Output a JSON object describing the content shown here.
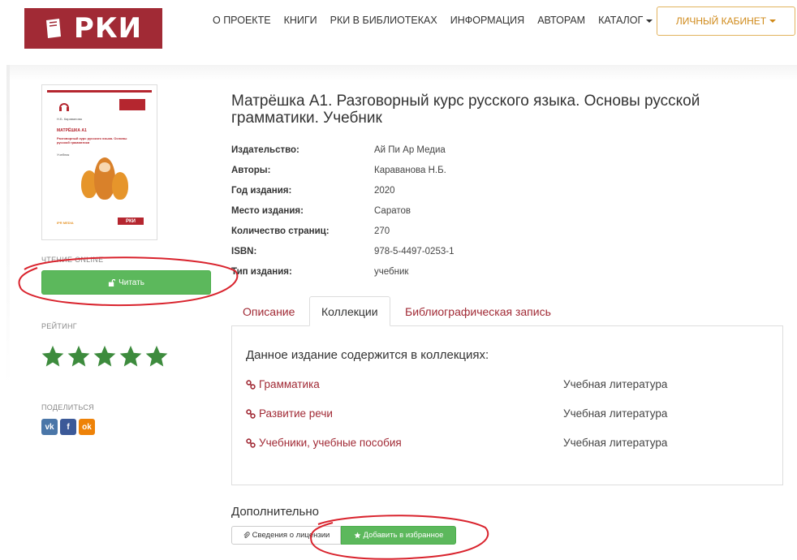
{
  "header": {
    "logo_text": "РКИ",
    "nav": [
      "О ПРОЕКТЕ",
      "КНИГИ",
      "РКИ В БИБЛИОТЕКАХ",
      "ИНФОРМАЦИЯ",
      "АВТОРАМ",
      "КАТАЛОГ"
    ],
    "cabinet_label": "ЛИЧНЫЙ КАБИНЕТ"
  },
  "cover": {
    "author": "Н.Б. Караванова",
    "title": "МАТРЁШКА А1",
    "subtitle": "Разговорный курс русского языка. Основы русской грамматики",
    "type": "Учебник",
    "publisher": "IPR MEDIA",
    "brand": "РКИ"
  },
  "sidebar": {
    "read_online_label": "ЧТЕНИЕ ONLINE",
    "read_button": "Читать",
    "rating_label": "РЕЙТИНГ",
    "rating_stars": 5,
    "share_label": "ПОДЕЛИТЬСЯ",
    "share_buttons": [
      "vk",
      "f",
      "ok"
    ]
  },
  "book": {
    "title": "Матрёшка А1. Разговорный курс русского языка. Основы русской грамматики. Учебник",
    "properties": [
      {
        "key": "Издательство:",
        "value": "Ай Пи Ар Медиа"
      },
      {
        "key": "Авторы:",
        "value": "Караванова Н.Б."
      },
      {
        "key": "Год издания:",
        "value": "2020"
      },
      {
        "key": "Место издания:",
        "value": "Саратов"
      },
      {
        "key": "Количество страниц:",
        "value": "270"
      },
      {
        "key": "ISBN:",
        "value": "978-5-4497-0253-1"
      },
      {
        "key": "Тип издания:",
        "value": "учебник"
      }
    ]
  },
  "tabs": {
    "items": [
      "Описание",
      "Коллекции",
      "Библиографическая запись"
    ],
    "active": "Коллекции"
  },
  "collections": {
    "heading": "Данное издание содержится в коллекциях:",
    "rows": [
      {
        "name": "Грамматика",
        "type": "Учебная литература"
      },
      {
        "name": "Развитие речи",
        "type": "Учебная литература"
      },
      {
        "name": "Учебники, учебные пособия",
        "type": "Учебная литература"
      }
    ]
  },
  "extra": {
    "title": "Дополнительно",
    "license_button": "Сведения о лицензии",
    "favorite_button": "Добавить в избранное"
  },
  "colors": {
    "brand": "#a12a35",
    "accent_green": "#5cb85c",
    "star_green": "#3d8b3d",
    "annotation_red": "#d9232d",
    "vk": "#4a76a8",
    "facebook": "#3b5998",
    "odnoklassniki": "#ee8208"
  }
}
